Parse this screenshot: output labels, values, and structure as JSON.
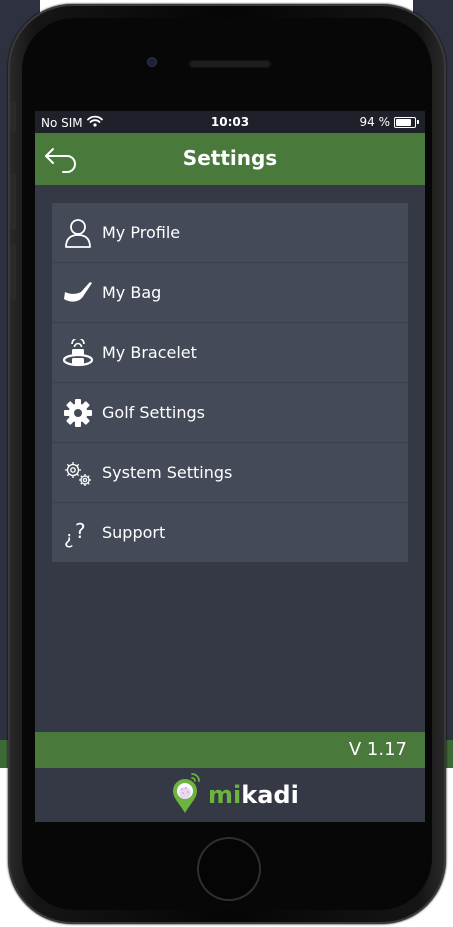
{
  "status_bar": {
    "carrier": "No SIM",
    "time": "10:03",
    "battery_percent_label": "94 %",
    "battery_level": 0.94,
    "wifi_icon": "wifi-icon",
    "battery_icon": "battery-icon"
  },
  "header": {
    "title": "Settings",
    "back_icon": "back-arrow-icon"
  },
  "menu": {
    "items": [
      {
        "label": "My Profile",
        "icon": "profile-icon"
      },
      {
        "label": "My Bag",
        "icon": "golf-club-icon"
      },
      {
        "label": "My Bracelet",
        "icon": "bracelet-icon"
      },
      {
        "label": "Golf Settings",
        "icon": "gear-icon"
      },
      {
        "label": "System Settings",
        "icon": "gears-icon"
      },
      {
        "label": "Support",
        "icon": "question-icon"
      }
    ]
  },
  "footer": {
    "version": "V 1.17",
    "brand_mi": "mi",
    "brand_kadi": "kadi",
    "logo_icon": "location-pin-golf-ball-icon"
  },
  "colors": {
    "accent_green": "#4a7a3b",
    "brand_green": "#6cb33f",
    "screen_bg": "#343945",
    "menu_bg": "#454a59"
  }
}
